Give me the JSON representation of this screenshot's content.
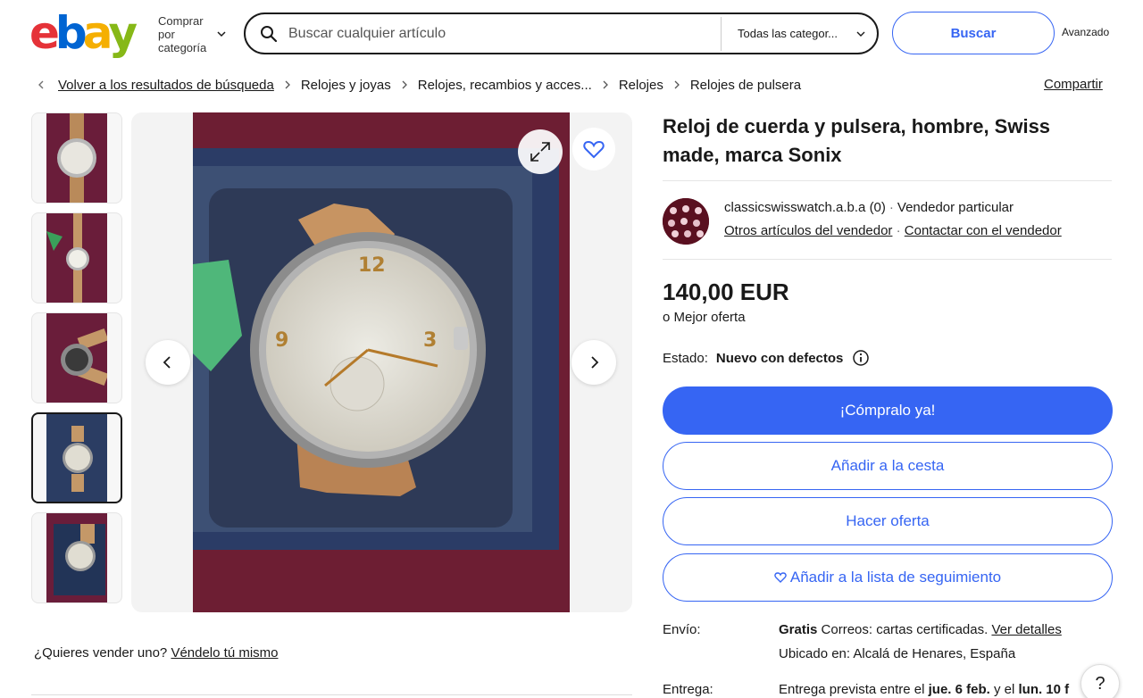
{
  "header": {
    "logo_letters": [
      "e",
      "b",
      "a",
      "y"
    ],
    "shop_by_category": "Comprar por categoría",
    "search_placeholder": "Buscar cualquier artículo",
    "category_select": "Todas las categor...",
    "search_button": "Buscar",
    "advanced_link": "Avanzado"
  },
  "breadcrumb": {
    "back_link": "Volver a los resultados de búsqueda",
    "items": [
      "Relojes y joyas",
      "Relojes, recambios y acces...",
      "Relojes",
      "Relojes de pulsera"
    ],
    "share": "Compartir"
  },
  "gallery": {
    "thumbnail_count": 5,
    "selected_index": 3,
    "sell_prompt": "¿Quieres vender uno?",
    "sell_link": "Véndelo tú mismo"
  },
  "listing": {
    "title": "Reloj de cuerda y pulsera, hombre, Swiss made, marca Sonix",
    "seller": {
      "name": "classicswisswatch.a.b.a",
      "feedback": "(0)",
      "type": "Vendedor particular",
      "other_items_link": "Otros artículos del vendedor",
      "contact_link": "Contactar con el vendedor"
    },
    "price": "140,00 EUR",
    "best_offer": "o Mejor oferta",
    "condition_label": "Estado:",
    "condition_value": "Nuevo con defectos",
    "buttons": {
      "buy_now": "¡Cómpralo ya!",
      "add_to_cart": "Añadir a la cesta",
      "make_offer": "Hacer oferta",
      "watchlist": "Añadir a la lista de seguimiento"
    },
    "shipping": {
      "label": "Envío:",
      "free": "Gratis",
      "method": "Correos: cartas certificadas.",
      "details_link": "Ver detalles",
      "location": "Ubicado en: Alcalá de Henares, España"
    },
    "delivery": {
      "label": "Entrega:",
      "prefix": "Entrega prevista entre el",
      "date_from": "jue. 6 feb.",
      "connector": "y el",
      "date_to": "lun. 10 f"
    }
  },
  "help_button": "?",
  "colors": {
    "accent": "#3665f3",
    "text": "#191919",
    "logo_e": "#e53238",
    "logo_b": "#0064d2",
    "logo_a": "#f5af02",
    "logo_y": "#86b817"
  }
}
